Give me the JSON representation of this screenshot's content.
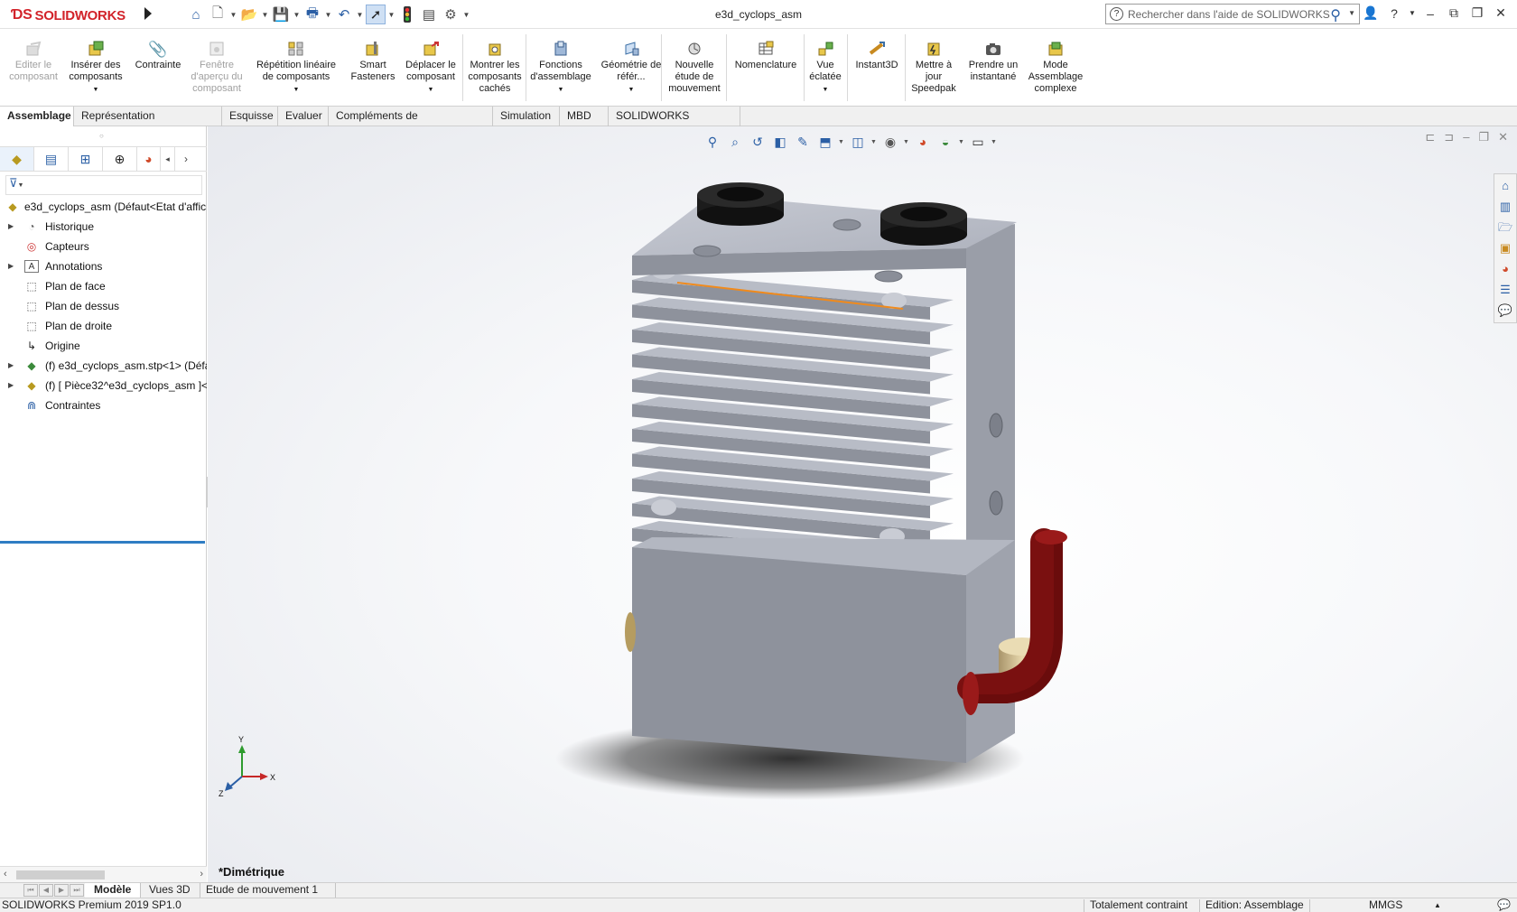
{
  "app": {
    "logo_brand": "SOLIDWORKS",
    "document_title": "e3d_cyclops_asm"
  },
  "quick_access": [
    {
      "icon": "home-icon"
    },
    {
      "icon": "new-document-icon"
    },
    {
      "icon": "open-folder-icon"
    },
    {
      "icon": "save-icon"
    },
    {
      "icon": "print-icon"
    },
    {
      "icon": "undo-icon"
    },
    {
      "icon": "select-pointer-icon"
    },
    {
      "icon": "rebuild-traffic-light-icon"
    },
    {
      "icon": "file-properties-icon"
    },
    {
      "icon": "options-gear-icon"
    }
  ],
  "search": {
    "placeholder": "Rechercher dans l'aide de SOLIDWORKS"
  },
  "ribbon": {
    "buttons": [
      {
        "label": "Editer le composant",
        "disabled": true
      },
      {
        "label": "Insérer des composants",
        "disabled": false
      },
      {
        "label": "Contrainte",
        "disabled": false
      },
      {
        "label": "Fenêtre d'aperçu du composant",
        "disabled": true
      },
      {
        "label": "Répétition linéaire de composants",
        "disabled": false
      },
      {
        "label": "Smart Fasteners",
        "disabled": false
      },
      {
        "label": "Déplacer le composant",
        "disabled": false
      },
      {
        "label": "Montrer les composants cachés",
        "disabled": false
      },
      {
        "label": "Fonctions d'assemblage",
        "disabled": false
      },
      {
        "label": "Géométrie de référ...",
        "disabled": false
      },
      {
        "label": "Nouvelle étude de mouvement",
        "disabled": false
      },
      {
        "label": "Nomenclature",
        "disabled": false
      },
      {
        "label": "Vue éclatée",
        "disabled": false
      },
      {
        "label": "Instant3D",
        "disabled": false
      },
      {
        "label": "Mettre à jour Speedpak",
        "disabled": false
      },
      {
        "label": "Prendre un instantané",
        "disabled": false
      },
      {
        "label": "Mode Assemblage complexe",
        "disabled": false
      }
    ]
  },
  "command_tabs": [
    "Assemblage",
    "Représentation schématique",
    "Esquisse",
    "Evaluer",
    "Compléments de SOLIDWORKS",
    "Simulation",
    "MBD",
    "SOLIDWORKS Inspection"
  ],
  "feature_tree": {
    "root": "e3d_cyclops_asm  (Défaut<Etat d'affic",
    "items": [
      {
        "label": "Historique",
        "icon": "history-folder-icon",
        "expandable": true
      },
      {
        "label": "Capteurs",
        "icon": "sensor-icon",
        "expandable": false
      },
      {
        "label": "Annotations",
        "icon": "annotations-icon",
        "expandable": true
      },
      {
        "label": "Plan de face",
        "icon": "plane-icon",
        "expandable": false
      },
      {
        "label": "Plan de dessus",
        "icon": "plane-icon",
        "expandable": false
      },
      {
        "label": "Plan de droite",
        "icon": "plane-icon",
        "expandable": false
      },
      {
        "label": "Origine",
        "icon": "origin-icon",
        "expandable": false
      },
      {
        "label": "(f) e3d_cyclops_asm.stp<1> (Défa",
        "icon": "subassembly-icon",
        "expandable": true
      },
      {
        "label": "(f) [ Pièce32^e3d_cyclops_asm ]<",
        "icon": "part-icon",
        "expandable": true
      },
      {
        "label": "Contraintes",
        "icon": "mates-icon",
        "expandable": false
      }
    ]
  },
  "viewport": {
    "view_orientation": "*Dimétrique",
    "triad": {
      "x": "X",
      "y": "Y",
      "z": "Z"
    }
  },
  "bottom_tabs": [
    "Modèle",
    "Vues 3D",
    "Etude de mouvement 1"
  ],
  "status": {
    "product": "SOLIDWORKS Premium 2019 SP1.0",
    "constraint": "Totalement contraint",
    "mode": "Edition: Assemblage",
    "units": "MMGS"
  },
  "colors": {
    "accent": "#2f7dc3",
    "logo_red": "#d2232a",
    "heatsink_grey": "#8e929c",
    "nozzle_red": "#7a1010",
    "fitting_brass": "#d6c396"
  }
}
